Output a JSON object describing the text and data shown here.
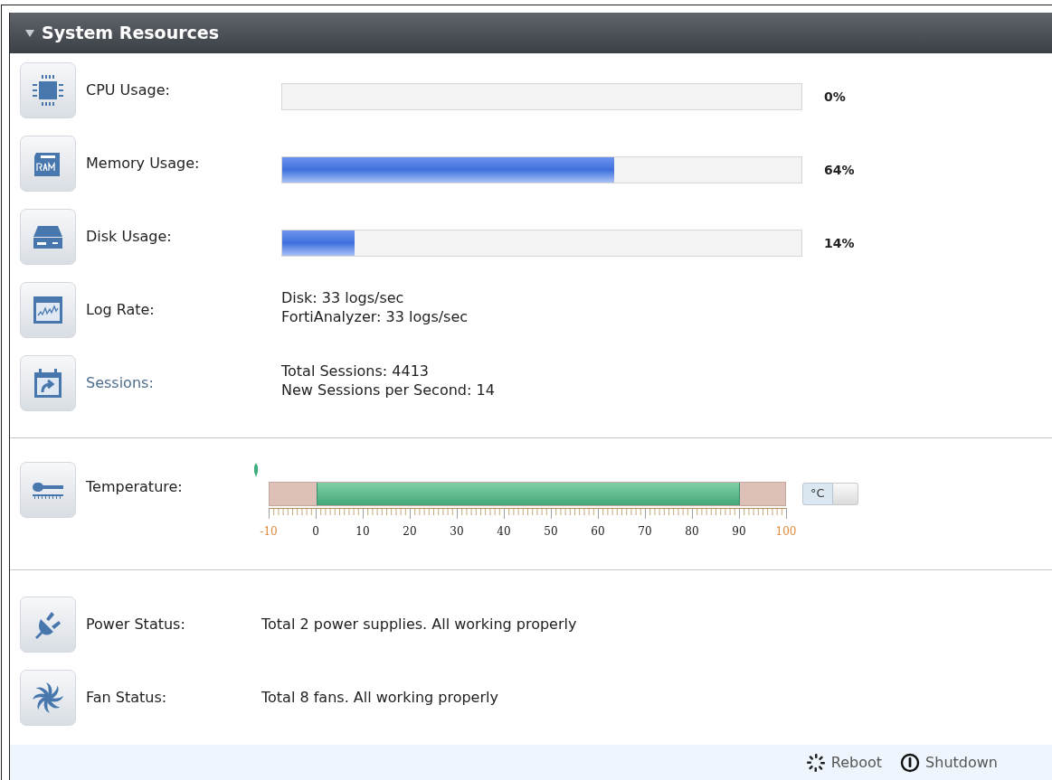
{
  "panel": {
    "title": "System Resources",
    "expanded": true
  },
  "cpu": {
    "label": "CPU Usage:",
    "level": 0,
    "reading": "0%"
  },
  "memory": {
    "label": "Memory Usage:",
    "level": 0.64,
    "reading": "64%"
  },
  "disk": {
    "label": "Disk Usage:",
    "level": 0.14,
    "reading": "14%"
  },
  "log_rate": {
    "label": "Log Rate:",
    "lines": [
      "Disk: 33 logs/sec",
      "FortiAnalyzer: 33 logs/sec"
    ]
  },
  "sessions": {
    "label": "Sessions:",
    "kind": "link",
    "lines": [
      "Total Sessions: 4413",
      "New Sessions per Second: 14"
    ]
  },
  "temperature": {
    "label": "Temperature:",
    "unit": "°C",
    "scale": [
      {
        "text": "-10",
        "kind": "limit"
      },
      {
        "text": "0",
        "kind": "normal"
      },
      {
        "text": "10",
        "kind": "normal"
      },
      {
        "text": "20",
        "kind": "normal"
      },
      {
        "text": "30",
        "kind": "normal"
      },
      {
        "text": "40",
        "kind": "normal"
      },
      {
        "text": "50",
        "kind": "normal"
      },
      {
        "text": "60",
        "kind": "normal"
      },
      {
        "text": "70",
        "kind": "normal"
      },
      {
        "text": "80",
        "kind": "normal"
      },
      {
        "text": "90",
        "kind": "normal"
      },
      {
        "text": "100",
        "kind": "limit"
      }
    ]
  },
  "power": {
    "label": "Power Status:",
    "value": "Total 2 power supplies. All working properly"
  },
  "fans": {
    "label": "Fan Status:",
    "value": "Total 8 fans. All working properly"
  },
  "footer": {
    "buttons": [
      {
        "kind": "reboot",
        "label": "Reboot"
      },
      {
        "kind": "shutdown",
        "label": "Shutdown"
      }
    ]
  }
}
